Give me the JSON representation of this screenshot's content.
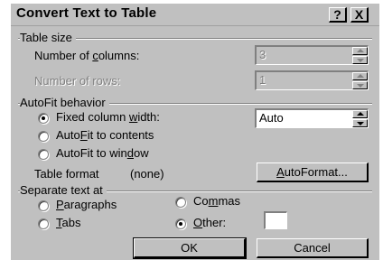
{
  "dialog": {
    "title": "Convert Text to Table",
    "help_button": "?",
    "close_button": "X"
  },
  "table_size": {
    "group_label": "Table size",
    "columns_label_pre": "Number of ",
    "columns_label_key": "c",
    "columns_label_post": "olumns:",
    "columns_value": "3",
    "rows_label": "Number of rows:",
    "rows_value": "1"
  },
  "autofit": {
    "group_label": "AutoFit behavior",
    "fixed_pre": "Fixed column ",
    "fixed_key": "w",
    "fixed_post": "idth:",
    "fixed_value": "Auto",
    "contents_pre": "Auto",
    "contents_key": "F",
    "contents_post": "it to contents",
    "window_pre": "AutoFit to win",
    "window_key": "d",
    "window_post": "ow",
    "selected": "fixed"
  },
  "table_format": {
    "label": "Table format",
    "value": "(none)",
    "button_pre": "",
    "button_key": "A",
    "button_post": "utoFormat..."
  },
  "separate": {
    "group_label": "Separate text at",
    "paragraphs_key": "P",
    "paragraphs_post": "aragraphs",
    "commas_pre": "Co",
    "commas_key": "m",
    "commas_post": "mas",
    "tabs_key": "T",
    "tabs_post": "abs",
    "other_key": "O",
    "other_post": "ther:",
    "other_value": "",
    "selected": "other"
  },
  "buttons": {
    "ok": "OK",
    "cancel": "Cancel"
  }
}
